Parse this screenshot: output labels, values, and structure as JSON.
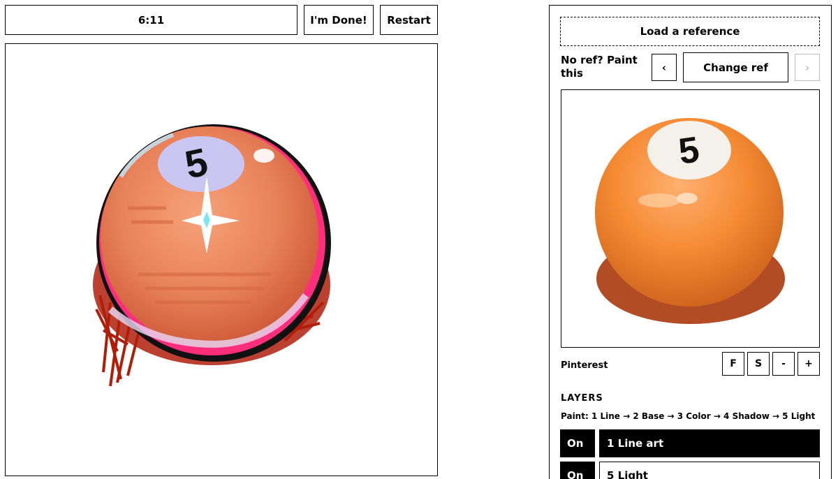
{
  "top_bar": {
    "timer": "6:11",
    "done_label": "I'm Done!",
    "restart_label": "Restart"
  },
  "canvas": {
    "ball_number": "5"
  },
  "reference_panel": {
    "load_label": "Load a reference",
    "no_ref_text": "No ref? Paint this",
    "prev_label": "‹",
    "change_label": "Change ref",
    "next_label": "›",
    "ball_number": "5",
    "source_label": "Pinterest",
    "controls": {
      "f": "F",
      "s": "S",
      "minus": "-",
      "plus": "+"
    }
  },
  "layers": {
    "heading": "LAYERS",
    "paint_order": "Paint: 1 Line → 2 Base → 3 Color → 4 Shadow → 5 Light",
    "items": [
      {
        "toggle": "On",
        "name": "1 Line art",
        "active": true
      },
      {
        "toggle": "On",
        "name": "5 Light",
        "active": false
      }
    ]
  },
  "colors": {
    "ball_orange": "#f08a3c",
    "painted_orange": "#e8825a",
    "accent_pink": "#ff2e7a",
    "shadow_red": "#b01e0a"
  }
}
